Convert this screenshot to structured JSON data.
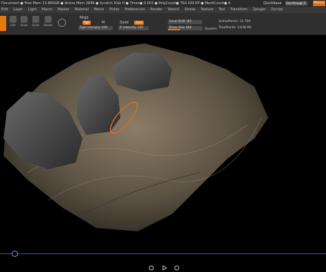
{
  "titlebar": {
    "status": "Document  ● Free Mem 13.865GB ● Active Mem 2846 ● Scratch Disk 0 ● Timer● 0.003 ● PolyCount● 764.109 KP ● MeshCount● 4",
    "quicksave": "QuickSave",
    "see_through": "See-through  0",
    "menus": "Menus"
  },
  "menubar": {
    "items": [
      "Edit",
      "Layer",
      "Light",
      "Macro",
      "Marker",
      "Material",
      "Movie",
      "Picker",
      "Preferences",
      "Render",
      "Stencil",
      "Stroke",
      "Texture",
      "Tool",
      "Transform",
      "Zplugin",
      "Zscript"
    ]
  },
  "toolbar": {
    "tools": [
      "Edit",
      "Draw",
      "Scale",
      "Rotate"
    ],
    "mrgb": "Mrgb",
    "rgb": "Rgb",
    "m": "M",
    "rgb_intensity": "Rgb Intensity 100",
    "zadd": "Zadd",
    "zsub": "Zsub",
    "z_intensity": "Z Intensity 100",
    "focal_shift": "Focal Shift -83",
    "draw_size": "Draw Size 394",
    "dynamic": "Dynamic",
    "active_points": "ActivePoints: 11.769",
    "total_points": "TotalPoints: 3.638 Mil",
    "colors": {
      "accent": "#e8780e"
    }
  },
  "bottom": {
    "icons": [
      "history-back-icon",
      "play-icon",
      "history-forward-icon"
    ]
  }
}
